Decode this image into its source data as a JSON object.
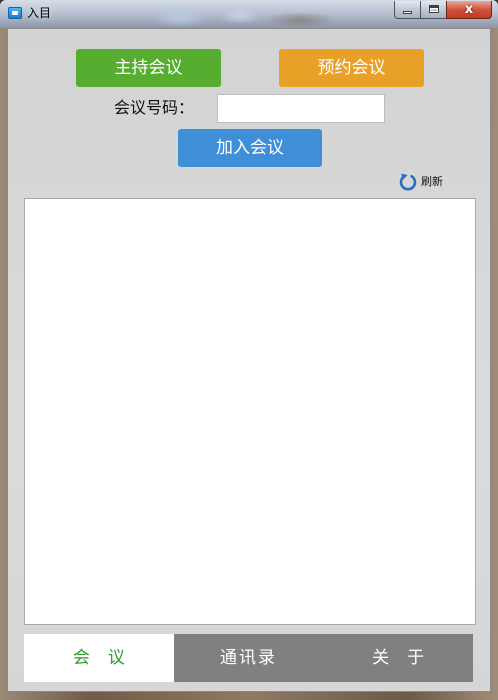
{
  "window": {
    "title": "入目",
    "icon": "app-icon",
    "controls": {
      "close_label": "x"
    }
  },
  "actions": {
    "host_label": "主持会议",
    "schedule_label": "预约会议",
    "join_label": "加入会议"
  },
  "meeting_id": {
    "label": "会议号码：",
    "value": "",
    "placeholder": ""
  },
  "refresh": {
    "label": "刷新",
    "icon": "refresh-icon"
  },
  "meeting_list": {
    "items": []
  },
  "tabs": [
    {
      "label": "会议",
      "active": true
    },
    {
      "label": "通讯录",
      "active": false
    },
    {
      "label": "关于",
      "active": false
    }
  ],
  "colors": {
    "host_button": "#56ad2f",
    "schedule_button": "#e9a027",
    "join_button": "#3f8ed8",
    "active_tab_text": "#2f9a2f",
    "tabbar_background": "#808080",
    "refresh_icon": "#2a6ebd"
  }
}
